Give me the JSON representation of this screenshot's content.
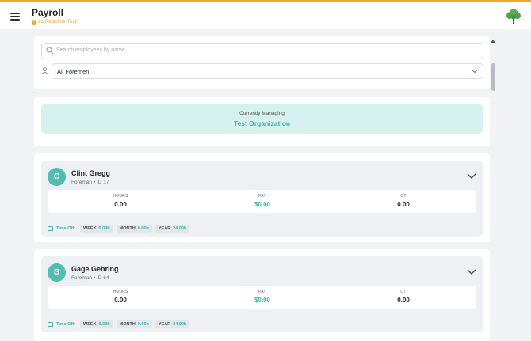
{
  "header": {
    "title": "Payroll",
    "subtitle": "as Redefine Test"
  },
  "filters": {
    "search_placeholder": "Search employees by name...",
    "foreman_select": "All Foremen"
  },
  "managing": {
    "label": "Currently Managing",
    "organization": "Test Organization"
  },
  "employees": [
    {
      "initial": "C",
      "name": "Clint Gregg",
      "role": "Foreman • ID 17",
      "hours_label": "HOURS",
      "hours": "0.00",
      "pay_label": "PAY",
      "pay": "$0.00",
      "ot_label": "OT",
      "ot": "0.00",
      "timeoff_label": "Time Off:",
      "week_label": "WEEK",
      "week": "0.00h",
      "month_label": "MONTH",
      "month": "0.00h",
      "year_label": "YEAR",
      "year": "24.00h"
    },
    {
      "initial": "G",
      "name": "Gage Gehring",
      "role": "Foreman • ID 64",
      "hours_label": "HOURS",
      "hours": "0.00",
      "pay_label": "PAY",
      "pay": "$0.00",
      "ot_label": "OT",
      "ot": "0.00",
      "timeoff_label": "Time Off:",
      "week_label": "WEEK",
      "week": "0.00h",
      "month_label": "MONTH",
      "month": "0.00h",
      "year_label": "YEAR",
      "year": "24.00h"
    }
  ],
  "colors": {
    "accent": "#3db5a8",
    "header_line": "#f0a830",
    "subtitle": "#e8a020"
  }
}
